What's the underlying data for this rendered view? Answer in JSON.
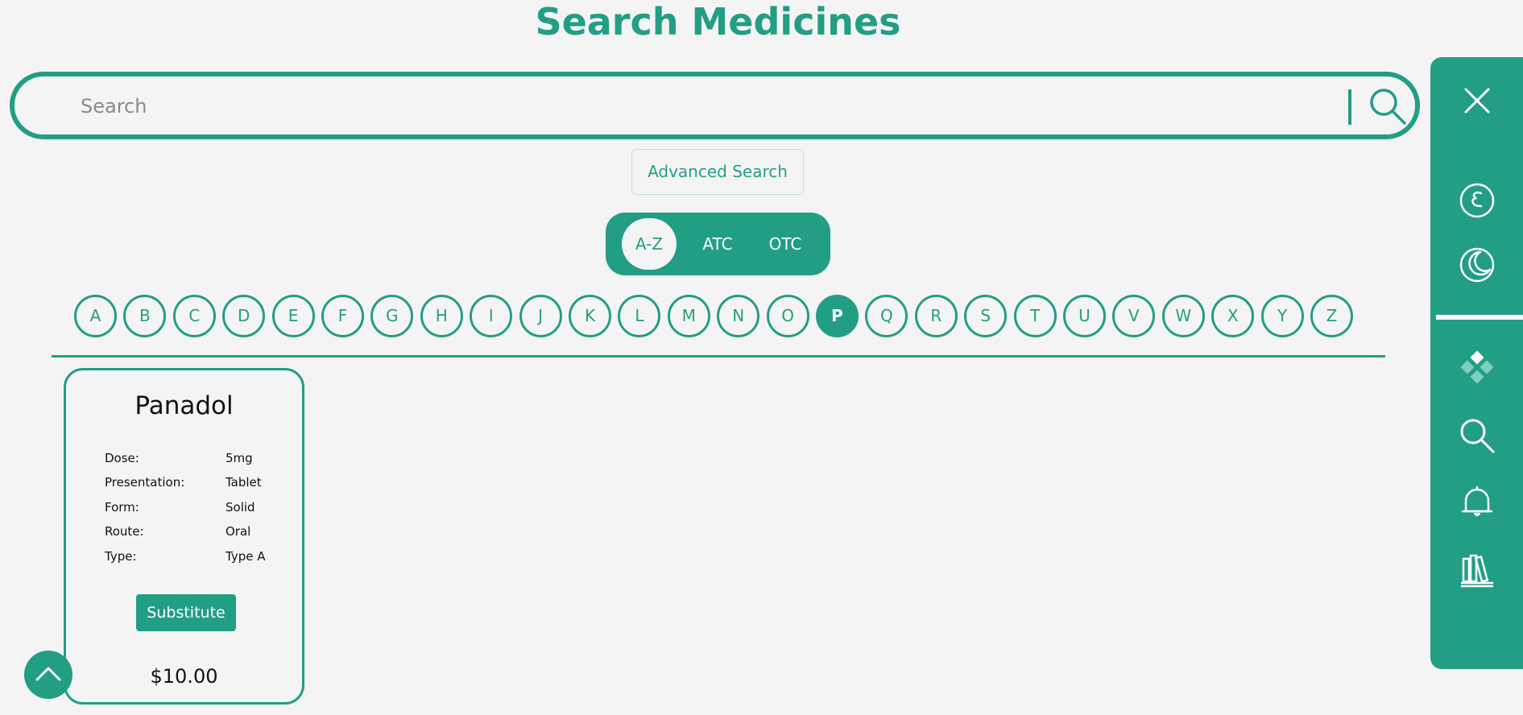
{
  "page": {
    "title": "Search Medicines"
  },
  "search": {
    "placeholder": "Search",
    "value": ""
  },
  "advanced_search": {
    "label": "Advanced Search"
  },
  "modes": [
    {
      "label": "A-Z",
      "active": true
    },
    {
      "label": "ATC",
      "active": false
    },
    {
      "label": "OTC",
      "active": false
    }
  ],
  "alphabet": [
    "A",
    "B",
    "C",
    "D",
    "E",
    "F",
    "G",
    "H",
    "I",
    "J",
    "K",
    "L",
    "M",
    "N",
    "O",
    "P",
    "Q",
    "R",
    "S",
    "T",
    "U",
    "V",
    "W",
    "X",
    "Y",
    "Z"
  ],
  "selected_letter": "P",
  "medicine": {
    "name": "Panadol",
    "props": [
      {
        "key": "Dose:",
        "value": "5mg"
      },
      {
        "key": "Presentation:",
        "value": "Tablet"
      },
      {
        "key": "Form:",
        "value": "Solid"
      },
      {
        "key": "Route:",
        "value": "Oral"
      },
      {
        "key": "Type:",
        "value": "Type A"
      }
    ],
    "substitute_label": "Substitute",
    "price": "$10.00"
  },
  "sidebar": {
    "icons": [
      "close-icon",
      "arabic-language-icon",
      "dark-mode-icon",
      "dashboard-icon",
      "search-icon",
      "notifications-icon",
      "library-icon"
    ]
  },
  "colors": {
    "accent": "#229e85",
    "background": "#f4f4f4"
  }
}
